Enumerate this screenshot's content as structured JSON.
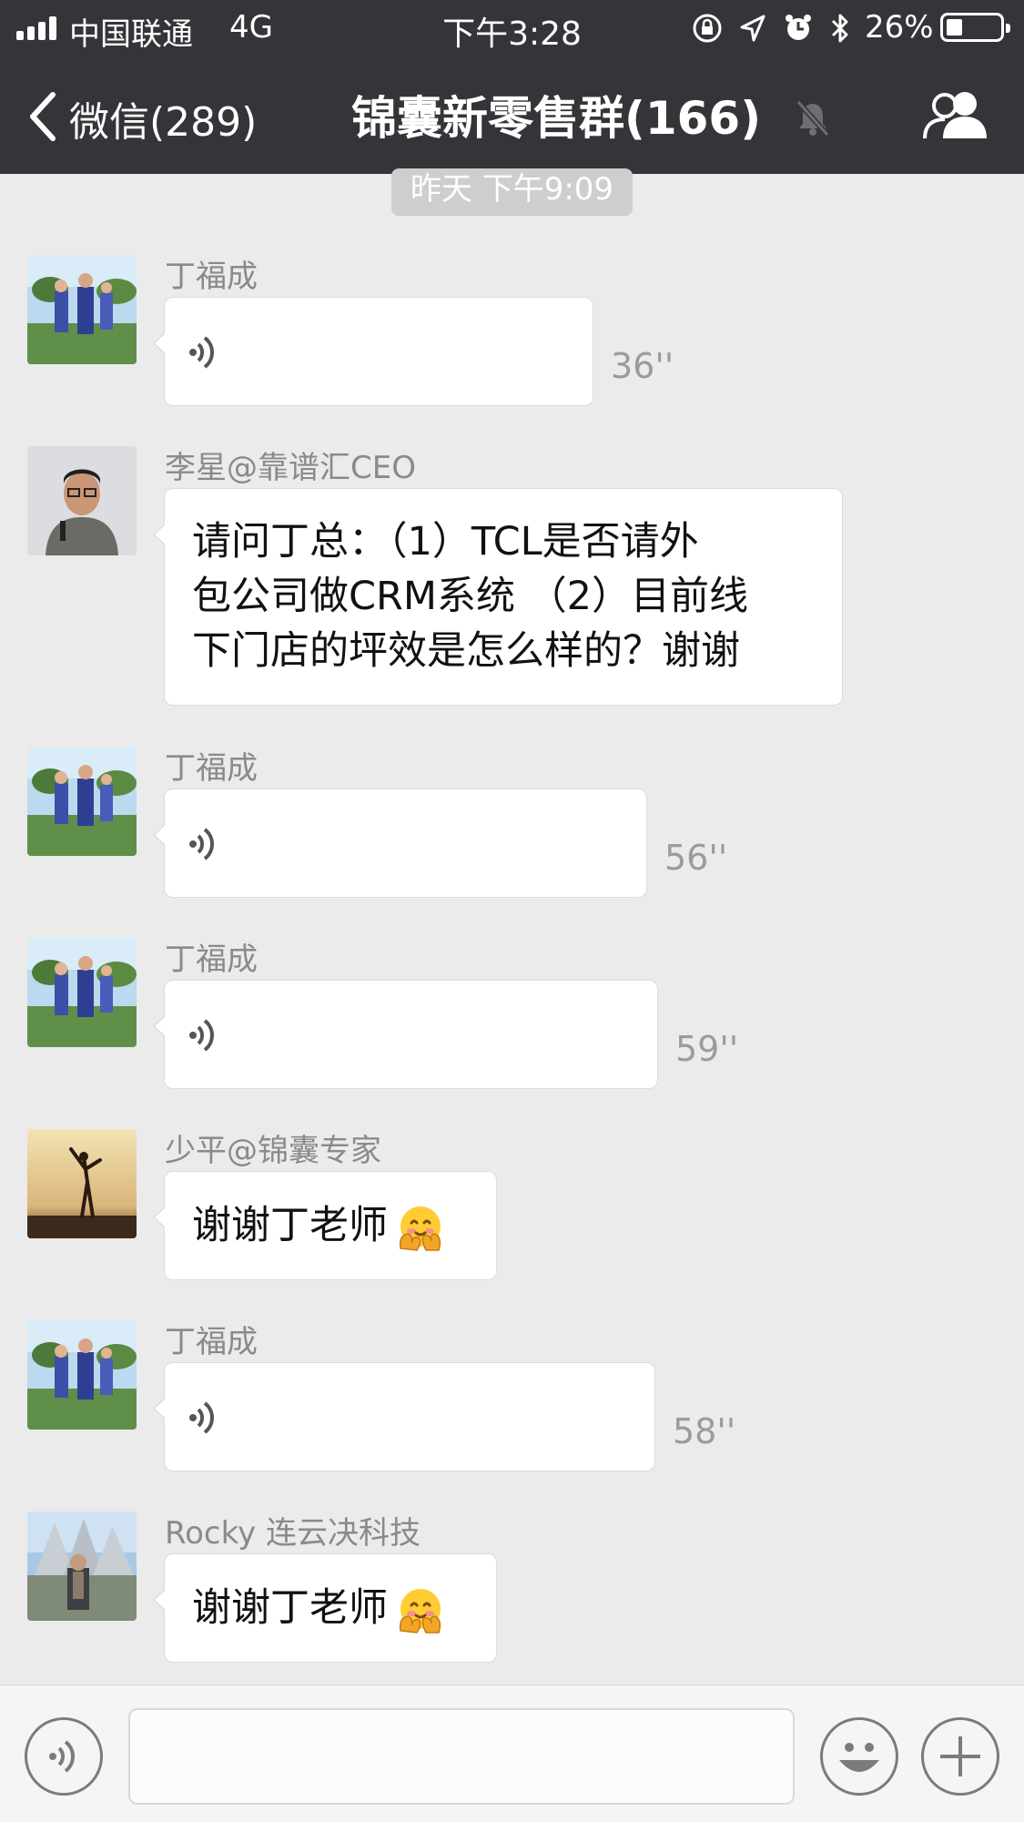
{
  "status_bar": {
    "carrier": "中国联通",
    "network": "4G",
    "time": "下午3:28",
    "battery_percent": "26%"
  },
  "nav": {
    "back_label": "微信(289)",
    "title": "锦囊新零售群(166)"
  },
  "timestamp": "昨天 下午9:09",
  "messages": [
    {
      "sender": "丁福成",
      "type": "voice",
      "duration": "36''"
    },
    {
      "sender": "李星@靠谱汇CEO",
      "type": "text",
      "lines": [
        "请问丁总：（1）TCL是否请外",
        "包公司做CRM系统 （2）目前线",
        "下门店的坪效是怎么样的？谢谢"
      ]
    },
    {
      "sender": "丁福成",
      "type": "voice",
      "duration": "56''"
    },
    {
      "sender": "丁福成",
      "type": "voice",
      "duration": "59''"
    },
    {
      "sender": "少平@锦囊专家",
      "type": "text",
      "lines": [
        "谢谢丁老师"
      ],
      "emoji": "hugging-face"
    },
    {
      "sender": "丁福成",
      "type": "voice",
      "duration": "58''"
    },
    {
      "sender": "Rocky 连云决科技",
      "type": "text",
      "lines": [
        "谢谢丁老师"
      ],
      "emoji": "hugging-face"
    }
  ],
  "colors": {
    "nav_bg": "#333538",
    "chat_bg": "#ebebeb",
    "bubble_bg": "#ffffff",
    "meta_text": "#8a8a8a"
  },
  "icons": {
    "back": "chevron-left-icon",
    "mute": "bell-slash-icon",
    "group": "group-icon",
    "voice": "voice-wave-icon",
    "emoji": "smiley-icon",
    "add": "plus-icon"
  }
}
